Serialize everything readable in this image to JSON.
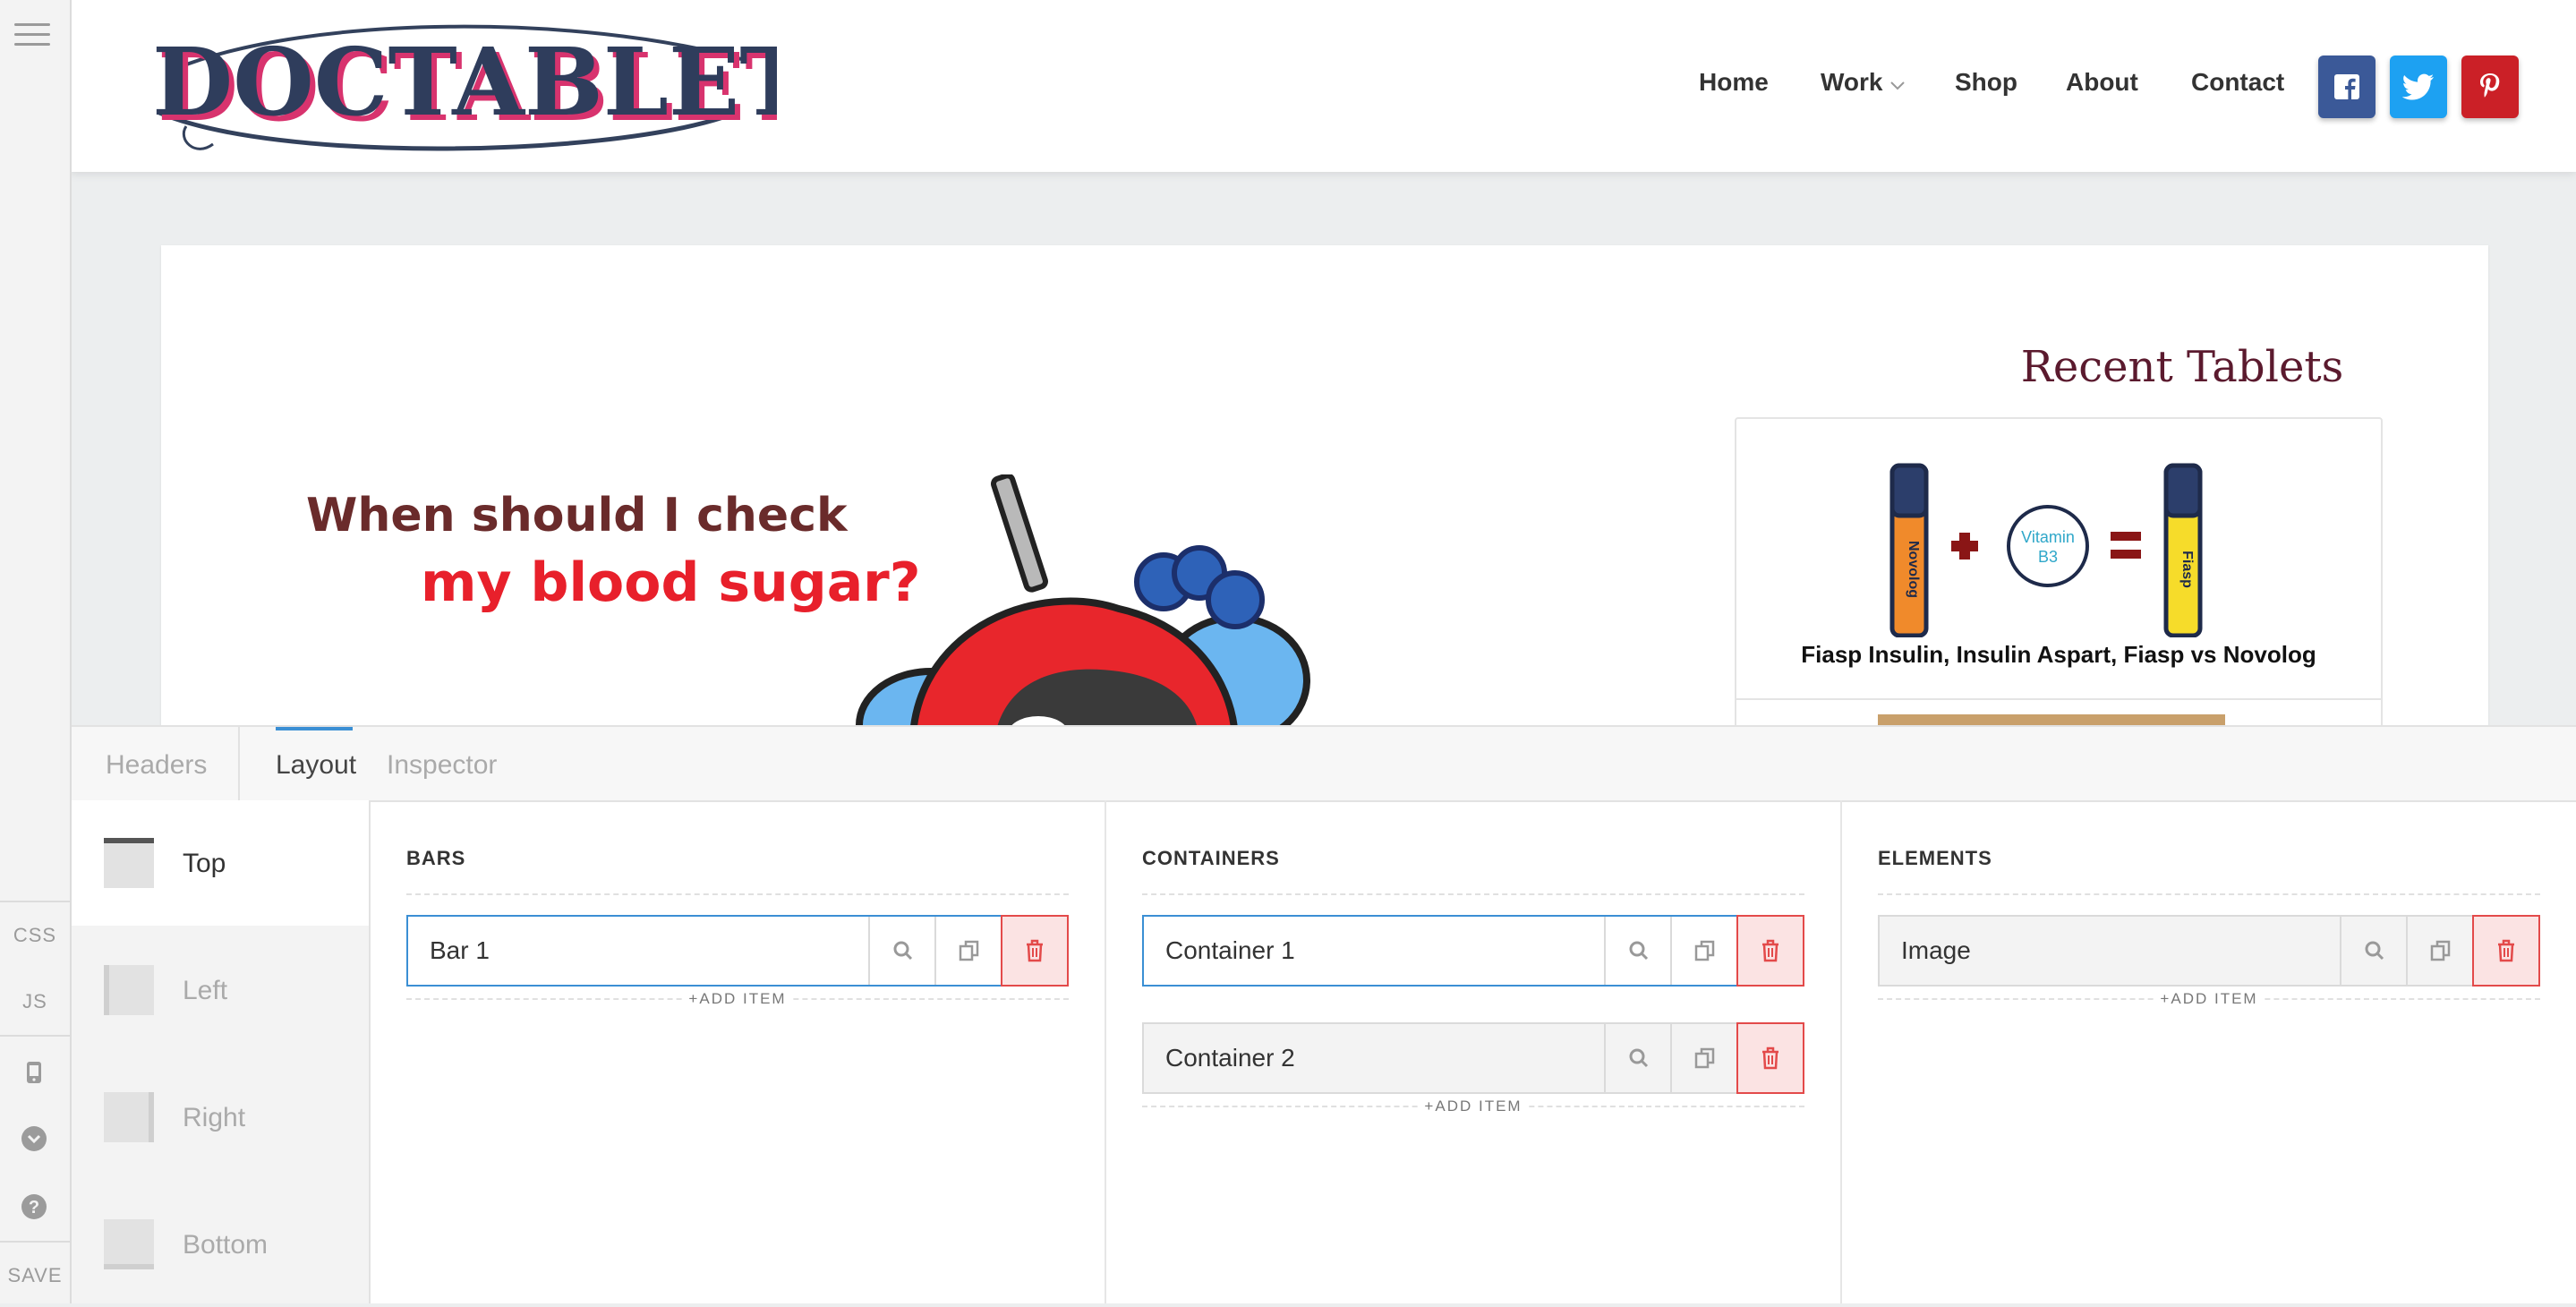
{
  "rail": {
    "css": "CSS",
    "js": "JS",
    "save": "SAVE"
  },
  "site": {
    "brand": "DOCTABLET",
    "nav": [
      "Home",
      "Work",
      "Shop",
      "About",
      "Contact"
    ],
    "social": [
      "facebook-icon",
      "twitter-icon",
      "pinterest-icon"
    ],
    "hero": {
      "line1": "When should I check",
      "line2": "my blood sugar?"
    },
    "recent_title": "Recent Tablets",
    "post_title": "Fiasp Insulin, Insulin Aspart, Fiasp vs Novolog",
    "post_art": {
      "vitamin_line1": "Vitamin",
      "vitamin_line2": "B3",
      "pen_left": "Novolog",
      "pen_right": "Fiasp"
    }
  },
  "panel": {
    "tabs": [
      "Headers",
      "Layout",
      "Inspector"
    ],
    "active_tab": "Layout",
    "positions": [
      "Top",
      "Left",
      "Right",
      "Bottom"
    ],
    "active_position": "Top",
    "columns": {
      "bars": {
        "title": "BARS",
        "items": [
          "Bar 1"
        ],
        "add_label": "+ADD ITEM"
      },
      "containers": {
        "title": "CONTAINERS",
        "items": [
          "Container 1",
          "Container 2"
        ],
        "add_label": "+ADD ITEM"
      },
      "elements": {
        "title": "ELEMENTS",
        "items": [
          "Image"
        ],
        "add_label": "+ADD ITEM"
      }
    }
  },
  "colors": {
    "accent": "#3b8fd4",
    "danger": "#e34a4a",
    "facebook": "#3b5998",
    "twitter": "#1da1f2",
    "pinterest": "#cb2027",
    "heading": "#5b1a2e"
  }
}
